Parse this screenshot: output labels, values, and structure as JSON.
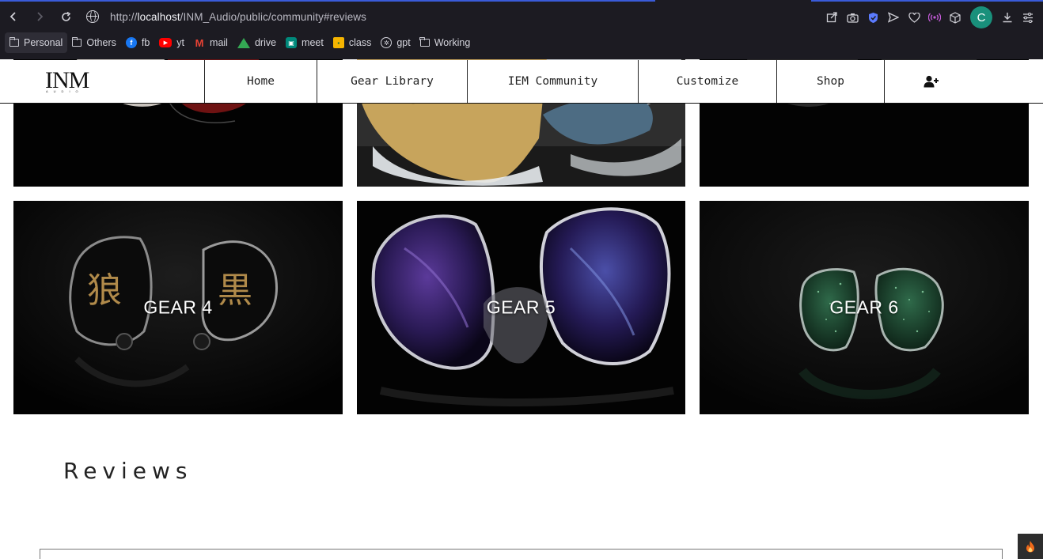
{
  "browser": {
    "url_host": "localhost",
    "url_prefix": "http://",
    "url_path": "/INM_Audio/public/community#reviews",
    "profile_initial": "C",
    "bookmarks": [
      {
        "label": "Personal",
        "icon": "folder-icon"
      },
      {
        "label": "Others",
        "icon": "folder-icon"
      },
      {
        "label": "fb",
        "icon": "facebook-icon"
      },
      {
        "label": "yt",
        "icon": "youtube-icon"
      },
      {
        "label": "mail",
        "icon": "gmail-icon"
      },
      {
        "label": "drive",
        "icon": "drive-icon"
      },
      {
        "label": "meet",
        "icon": "meet-icon"
      },
      {
        "label": "class",
        "icon": "classroom-icon"
      },
      {
        "label": "gpt",
        "icon": "chatgpt-icon"
      },
      {
        "label": "Working",
        "icon": "folder-icon"
      }
    ]
  },
  "site": {
    "logo": "INM",
    "logo_sub": "AUDIO",
    "nav": [
      "Home",
      "Gear Library",
      "IEM Community",
      "Customize",
      "Shop"
    ],
    "account_icon": "user-plus-icon"
  },
  "gallery": {
    "cards": [
      {
        "label": "GEAR 4"
      },
      {
        "label": "GEAR 5"
      },
      {
        "label": "GEAR 6"
      }
    ]
  },
  "reviews": {
    "title": "Reviews"
  },
  "colors": {
    "accent": "#3a5bd9",
    "chrome_bg": "#1c1b22",
    "avatar": "#19907b"
  }
}
